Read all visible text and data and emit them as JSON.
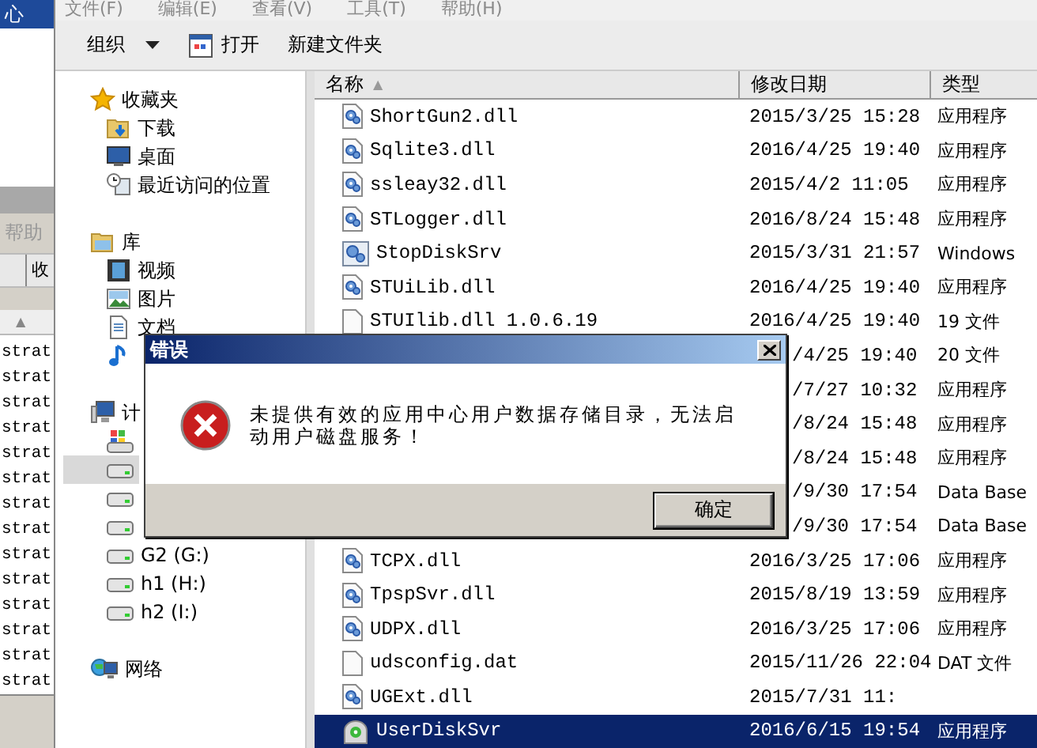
{
  "background_window": {
    "title": "心",
    "menu": "帮助",
    "tab": "收",
    "sort_indicator": "▲",
    "rows": [
      "strat",
      "strat",
      "strat",
      "strat",
      "strat",
      "strat",
      "strat",
      "strat",
      "strat",
      "strat",
      "strat",
      "strat",
      "strat",
      "strat"
    ]
  },
  "explorer": {
    "menu": [
      "文件(F)",
      "编辑(E)",
      "查看(V)",
      "工具(T)",
      "帮助(H)"
    ],
    "toolbar": [
      {
        "label": "组织",
        "kind": "dropdown"
      },
      {
        "label": "打开",
        "kind": "open"
      },
      {
        "label": "新建文件夹",
        "kind": "plain"
      }
    ],
    "nav": [
      {
        "label": "收藏夹",
        "kind": "star",
        "selected": false,
        "children": [
          {
            "label": "下载",
            "kind": "download",
            "selected": false
          },
          {
            "label": "桌面",
            "kind": "desktop",
            "selected": false
          },
          {
            "label": "最近访问的位置",
            "kind": "recent",
            "selected": false
          }
        ]
      },
      {
        "label": "库",
        "kind": "library",
        "selected": false,
        "children": [
          {
            "label": "视频",
            "kind": "video",
            "selected": false
          },
          {
            "label": "图片",
            "kind": "picture",
            "selected": false
          },
          {
            "label": "文档",
            "kind": "document",
            "selected": false
          },
          {
            "kind": "music",
            "selected": false
          }
        ]
      },
      {
        "label": "计",
        "kind": "computer",
        "selected": false,
        "children": [
          {
            "kind": "system-drive",
            "selected": false
          },
          {
            "kind": "drive",
            "selected": true
          },
          {
            "kind": "drive",
            "selected": false
          },
          {
            "kind": "drive",
            "selected": false
          },
          {
            "label": "G2 (G:)",
            "kind": "drive",
            "selected": false
          },
          {
            "label": "h1 (H:)",
            "kind": "drive",
            "selected": false
          },
          {
            "label": "h2 (I:)",
            "kind": "drive",
            "selected": false
          }
        ]
      },
      {
        "label": "网络",
        "kind": "network",
        "selected": false
      }
    ],
    "columns": [
      {
        "label": "名称",
        "sort": "▲"
      },
      {
        "label": "修改日期"
      },
      {
        "label": "类型"
      }
    ],
    "files": [
      {
        "name": "ShortGun2.dll",
        "kind": "dll",
        "date": "2015/3/25 15:28",
        "type": "应用程序",
        "selected": false
      },
      {
        "name": "Sqlite3.dll",
        "kind": "dll",
        "date": "2016/4/25 19:40",
        "type": "应用程序",
        "selected": false
      },
      {
        "name": "ssleay32.dll",
        "kind": "dll",
        "date": "2015/4/2 11:05",
        "type": "应用程序",
        "selected": false
      },
      {
        "name": "STLogger.dll",
        "kind": "dll",
        "date": "2016/8/24 15:48",
        "type": "应用程序",
        "selected": false
      },
      {
        "name": "StopDiskSrv",
        "kind": "service",
        "date": "2015/3/31 21:57",
        "type": "Windows",
        "selected": false
      },
      {
        "name": "STUiLib.dll",
        "kind": "dll",
        "date": "2016/4/25 19:40",
        "type": "应用程序",
        "selected": false
      },
      {
        "name": "STUIlib.dll 1.0.6.19",
        "kind": "blank",
        "date": "2016/4/25 19:40",
        "type": "19 文件",
        "selected": false
      },
      {
        "date": "/4/25 19:40",
        "type": "20 文件",
        "selected": false
      },
      {
        "date": "/7/27 10:32",
        "type": "应用程序",
        "selected": false
      },
      {
        "date": "/8/24 15:48",
        "type": "应用程序",
        "selected": false
      },
      {
        "date": "/8/24 15:48",
        "type": "应用程序",
        "selected": false
      },
      {
        "date": "/9/30 17:54",
        "type": "Data Base",
        "selected": false
      },
      {
        "date": "/9/30 17:54",
        "type": "Data Base",
        "selected": false
      },
      {
        "name": "TCPX.dll",
        "kind": "dll",
        "date": "2016/3/25 17:06",
        "type": "应用程序",
        "selected": false
      },
      {
        "name": "TpspSvr.dll",
        "kind": "dll",
        "date": "2015/8/19 13:59",
        "type": "应用程序",
        "selected": false
      },
      {
        "name": "UDPX.dll",
        "kind": "dll",
        "date": "2016/3/25 17:06",
        "type": "应用程序",
        "selected": false
      },
      {
        "name": "udsconfig.dat",
        "kind": "blank",
        "date": "2015/11/26 22:04",
        "type": "DAT 文件",
        "selected": false
      },
      {
        "name": "UGExt.dll",
        "kind": "dll",
        "date": "2015/7/31 11:",
        "selected": false
      },
      {
        "name": "UserDiskSvr",
        "kind": "app",
        "date": "2016/6/15 19:54",
        "type": "应用程序",
        "selected": true
      }
    ]
  },
  "dialog": {
    "title": "错误",
    "message": "未提供有效的应用中心用户数据存储目录，无法启动用户磁盘服务！",
    "button": "确定"
  }
}
